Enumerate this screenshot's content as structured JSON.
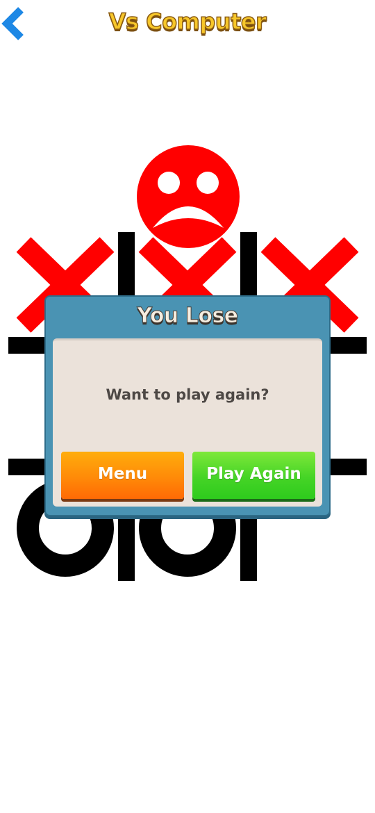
{
  "header": {
    "title": "Vs Computer",
    "back_icon": "chevron-left-icon"
  },
  "board": {
    "cells": [
      "X",
      "X",
      "X",
      "",
      "",
      "",
      "O",
      "O",
      ""
    ],
    "result_icon": "sad-face-icon"
  },
  "dialog": {
    "title": "You Lose",
    "message": "Want to play again?",
    "menu_label": "Menu",
    "play_again_label": "Play Again"
  },
  "colors": {
    "title_fill": "#f7c72a",
    "back_icon": "#1e88e5",
    "x_mark": "#ff0000",
    "o_mark": "#000000",
    "sad_face": "#ff0000",
    "dialog_frame": "#4a93b3",
    "dialog_body": "#ebe2da",
    "menu_button": "#ff8a08",
    "play_button": "#45d426"
  }
}
